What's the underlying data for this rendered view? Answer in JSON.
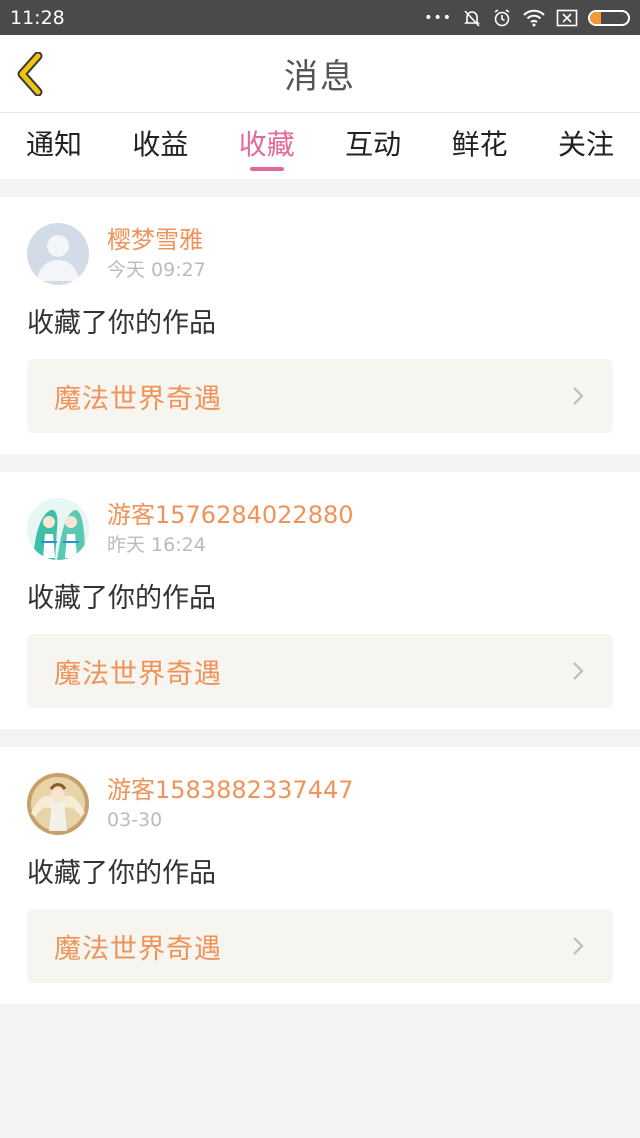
{
  "status_bar": {
    "time": "11:28",
    "more_glyph": "•••",
    "icons": [
      "more-dots-icon",
      "mute-bell-icon",
      "alarm-icon",
      "wifi-icon",
      "sim-x-icon",
      "battery-icon"
    ],
    "battery_level": 0.3,
    "battery_color": "#f29a38"
  },
  "header": {
    "title": "消息",
    "back_icon": "chevron-left-icon",
    "back_color": "#f1c40f"
  },
  "tabs": {
    "active_index": 2,
    "active_color": "#e4699a",
    "items": [
      {
        "label": "通知"
      },
      {
        "label": "收益"
      },
      {
        "label": "收藏"
      },
      {
        "label": "互动"
      },
      {
        "label": "鲜花"
      },
      {
        "label": "关注"
      }
    ]
  },
  "messages": [
    {
      "username": "樱梦雪雅",
      "time": "今天 09:27",
      "action": "收藏了你的作品",
      "work_title": "魔法世界奇遇",
      "avatar": "default-avatar-icon"
    },
    {
      "username": "游客1576284022880",
      "time": "昨天 16:24",
      "action": "收藏了你的作品",
      "work_title": "魔法世界奇遇",
      "avatar": "anime-avatar-green"
    },
    {
      "username": "游客1583882337447",
      "time": "03-30",
      "action": "收藏了你的作品",
      "work_title": "魔法世界奇遇",
      "avatar": "anime-avatar-angel"
    }
  ],
  "colors": {
    "accent_orange": "#f0935a",
    "work_box_bg": "#f6f5ef",
    "page_bg": "#f3f3f3"
  }
}
